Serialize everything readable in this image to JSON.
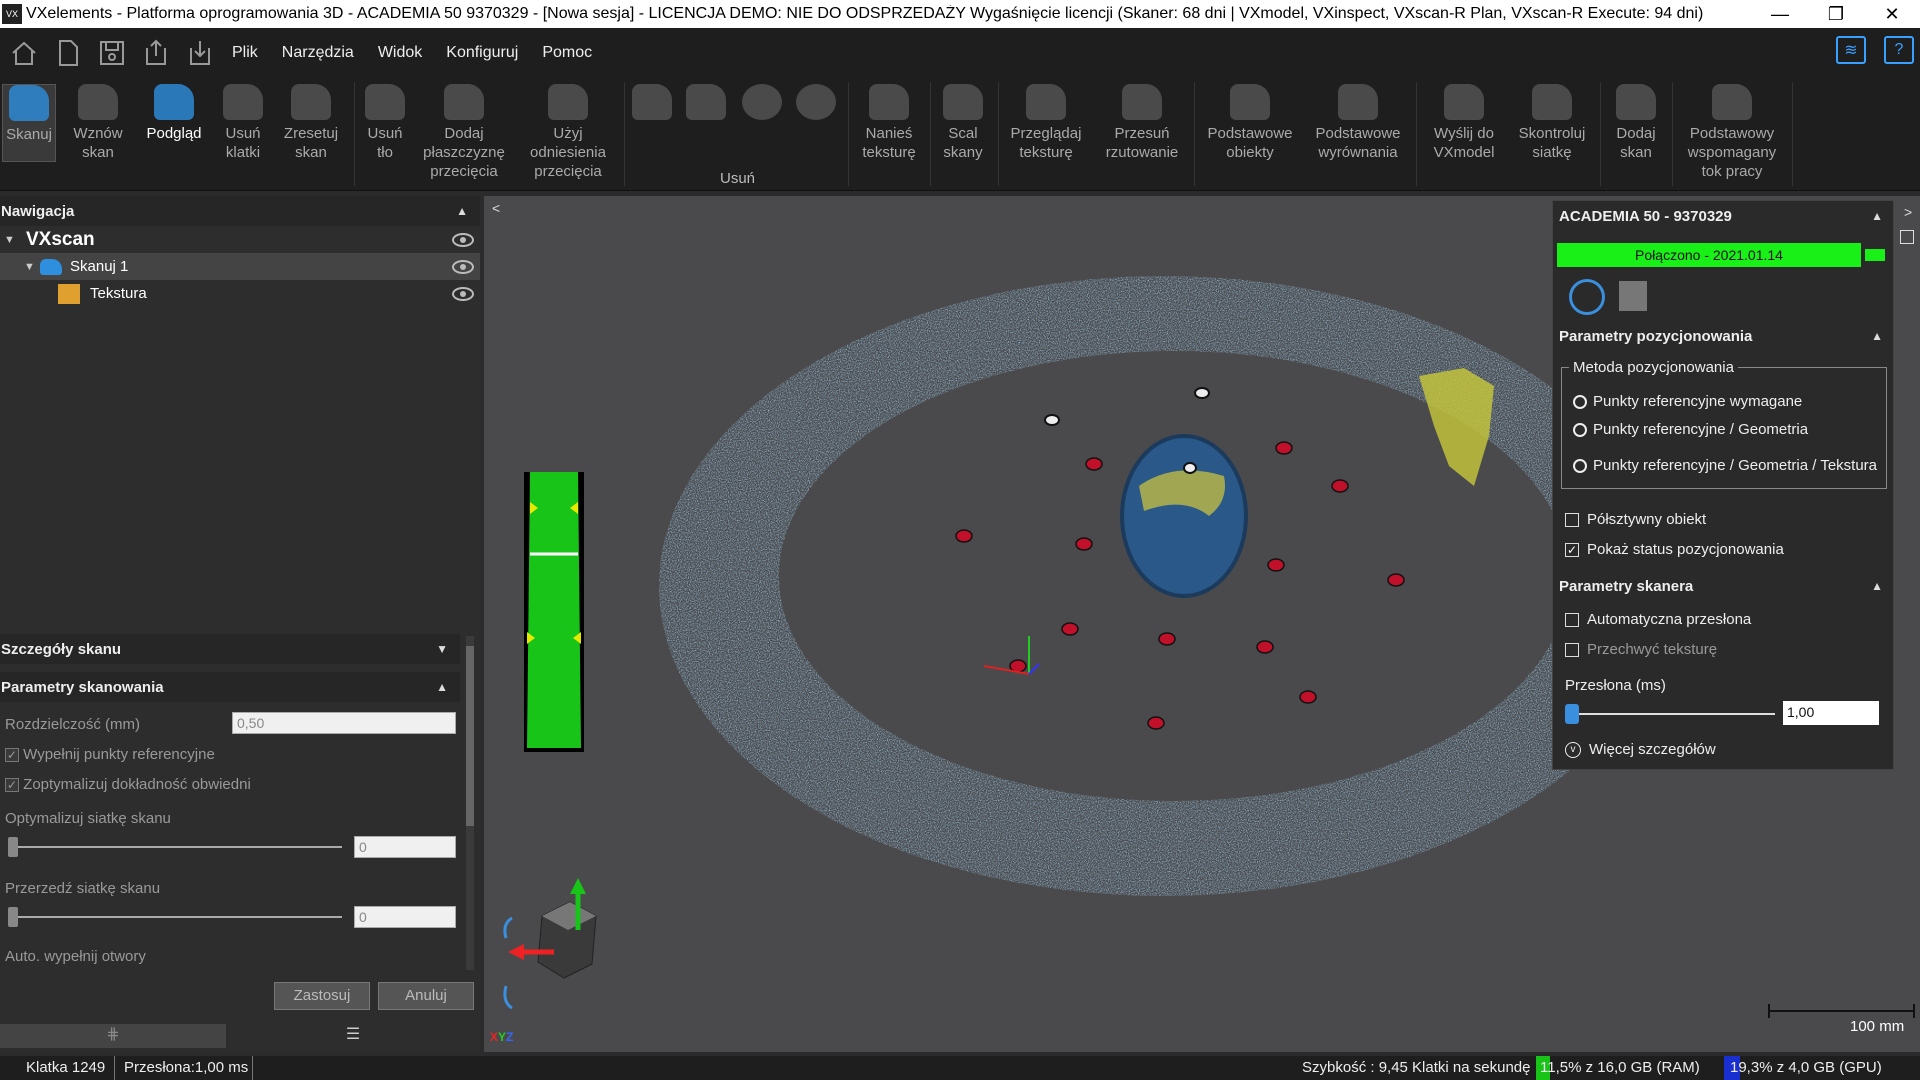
{
  "titlebar": {
    "title": "VXelements - Platforma oprogramowania 3D - ACADEMIA 50 9370329 - [Nowa sesja] - LICENCJA DEMO: NIE DO ODSPRZEDAŻY Wygaśnięcie licencji (Skaner: 68 dni | VXmodel, VXinspect, VXscan-R Plan, VXscan-R Execute: 94 dni)",
    "app_icon": "VX",
    "minimize": "—",
    "restore": "❐",
    "close": "✕"
  },
  "menu": {
    "items": [
      "Plik",
      "Narzędzia",
      "Widok",
      "Konfiguruj",
      "Pomoc"
    ],
    "wifi_icon": "wifi-icon",
    "help_icon": "?"
  },
  "ribbon": {
    "buttons": [
      {
        "label": "Skanuj",
        "state": "active"
      },
      {
        "label": "Wznów\nskan"
      },
      {
        "label": "Podgląd",
        "state": "bright"
      },
      {
        "label": "Usuń\nklatki"
      },
      {
        "label": "Zresetuj\nskan"
      },
      {
        "label": "Usuń\ntło"
      },
      {
        "label": "Dodaj\npłaszczyznę\nprzecięcia"
      },
      {
        "label": "Użyj\nodniesienia\nprzecięcia"
      },
      {
        "label": "Nanieś\nteksturę"
      },
      {
        "label": "Scal\nskany"
      },
      {
        "label": "Przeglądaj\nteksturę"
      },
      {
        "label": "Przesuń\nrzutowanie"
      },
      {
        "label": "Podstawowe\nobiekty"
      },
      {
        "label": "Podstawowe\nwyrównania"
      },
      {
        "label": "Wyślij do\nVXmodel"
      },
      {
        "label": "Skontroluj\nsiatkę"
      },
      {
        "label": "Dodaj\nskan"
      },
      {
        "label": "Podstawowy\nwspomagany\ntok pracy"
      }
    ],
    "remove_group_label": "Usuń"
  },
  "navigation": {
    "title": "Nawigacja",
    "tree": [
      {
        "label": "VXscan",
        "level": 0
      },
      {
        "label": "Skanuj 1",
        "level": 1
      },
      {
        "label": "Tekstura",
        "level": 2
      }
    ]
  },
  "scan_details": {
    "title": "Szczegóły skanu",
    "params_title": "Parametry skanowania",
    "resolution_label": "Rozdzielczość (mm)",
    "resolution_value": "0,50",
    "fill_refs": "Wypełnij punkty referencyjne",
    "optimize_accuracy": "Zoptymalizuj dokładność obwiedni",
    "optimize_mesh": "Optymalizuj siatkę skanu",
    "optimize_mesh_value": "0",
    "decimate_mesh": "Przerzedź siatkę skanu",
    "decimate_mesh_value": "0",
    "auto_fill": "Auto. wypełnij otwory",
    "apply": "Zastosuj",
    "cancel": "Anuluj"
  },
  "scanner_panel": {
    "title": "ACADEMIA 50 - 9370329",
    "connected": "Połączono - 2021.01.14",
    "positioning_title": "Parametry pozycjonowania",
    "method_label": "Metoda pozycjonowania",
    "methods": [
      "Punkty referencyjne wymagane",
      "Punkty referencyjne / Geometria",
      "Punkty referencyjne / Geometria / Tekstura"
    ],
    "semi_rigid": "Półsztywny obiekt",
    "show_status": "Pokaż status pozycjonowania",
    "scanner_params_title": "Parametry skanera",
    "auto_shutter": "Automatyczna przesłona",
    "capture_texture": "Przechwyć teksturę",
    "shutter_label": "Przesłona (ms)",
    "shutter_value": "1,00",
    "more_details": "Więcej szczegółów"
  },
  "viewport": {
    "scale_label": "100 mm",
    "axes_label": [
      "X",
      "Y",
      "Z"
    ],
    "colors": {
      "scan_blue": "#4f86b8",
      "target_red": "#c0102a",
      "green_bar": "#18c418"
    }
  },
  "status": {
    "frame": "Klatka 1249",
    "shutter": "Przesłona:1,00 ms",
    "speed": "Szybkość : 9,45 Klatki na sekundę",
    "ram": "11,5% z 16,0 GB (RAM)",
    "gpu": "19,3% z 4,0 GB (GPU)"
  }
}
